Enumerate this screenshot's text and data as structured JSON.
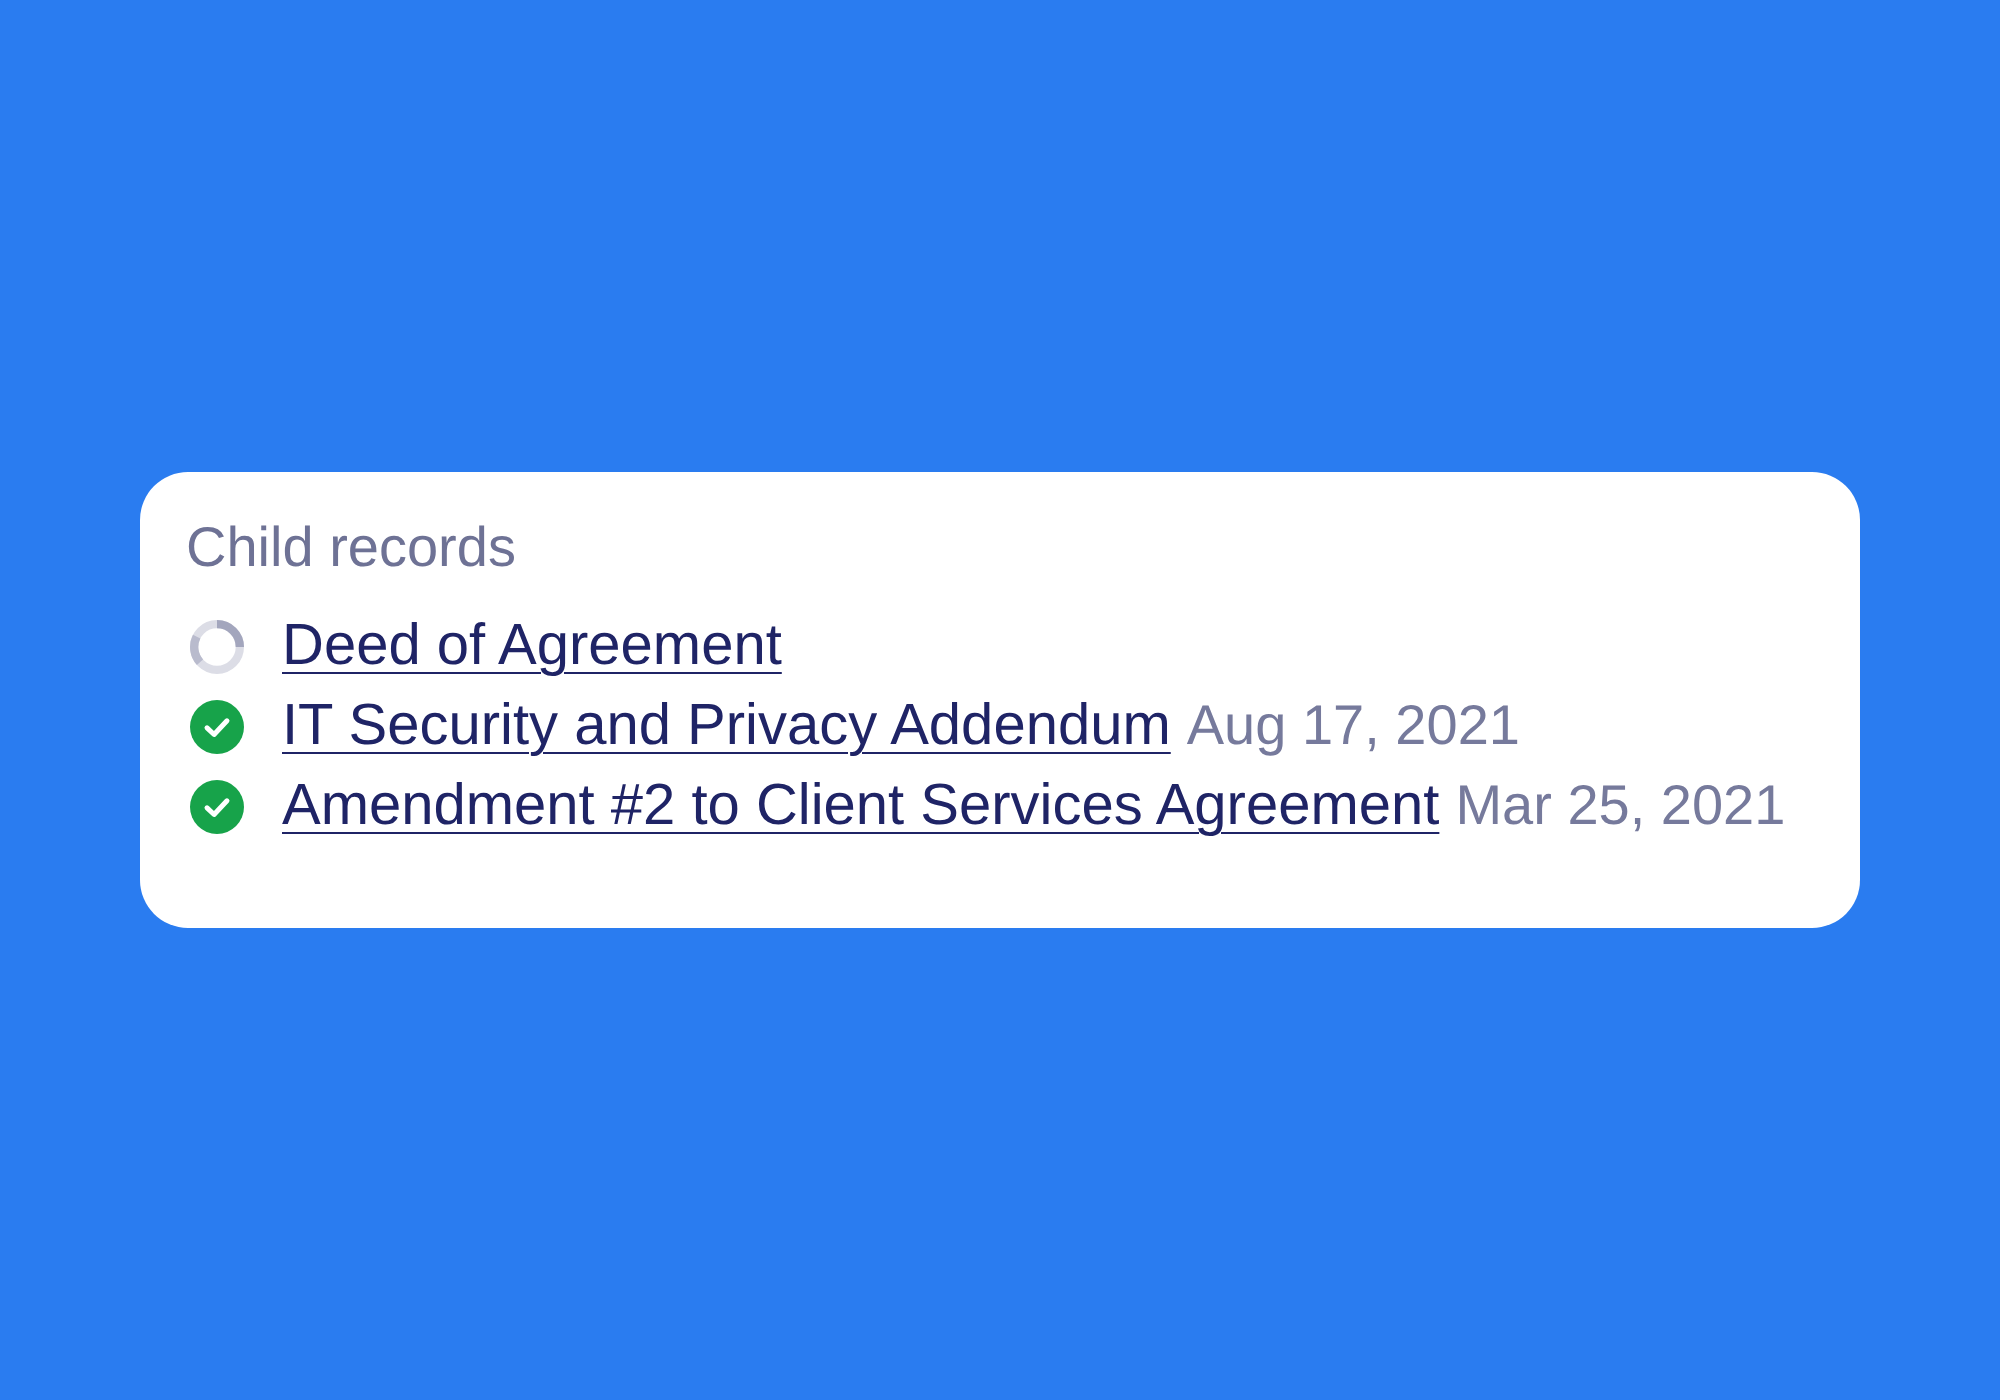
{
  "panel": {
    "title": "Child records",
    "records": [
      {
        "title": "Deed of Agreement",
        "done": false
      },
      {
        "title": "IT Security and Privacy Addendum",
        "done": true,
        "date": "Aug 17, 2021"
      },
      {
        "title": "Amendment #2 to Client Services Agreement",
        "done": true,
        "date": "Mar 25, 2021"
      }
    ]
  }
}
